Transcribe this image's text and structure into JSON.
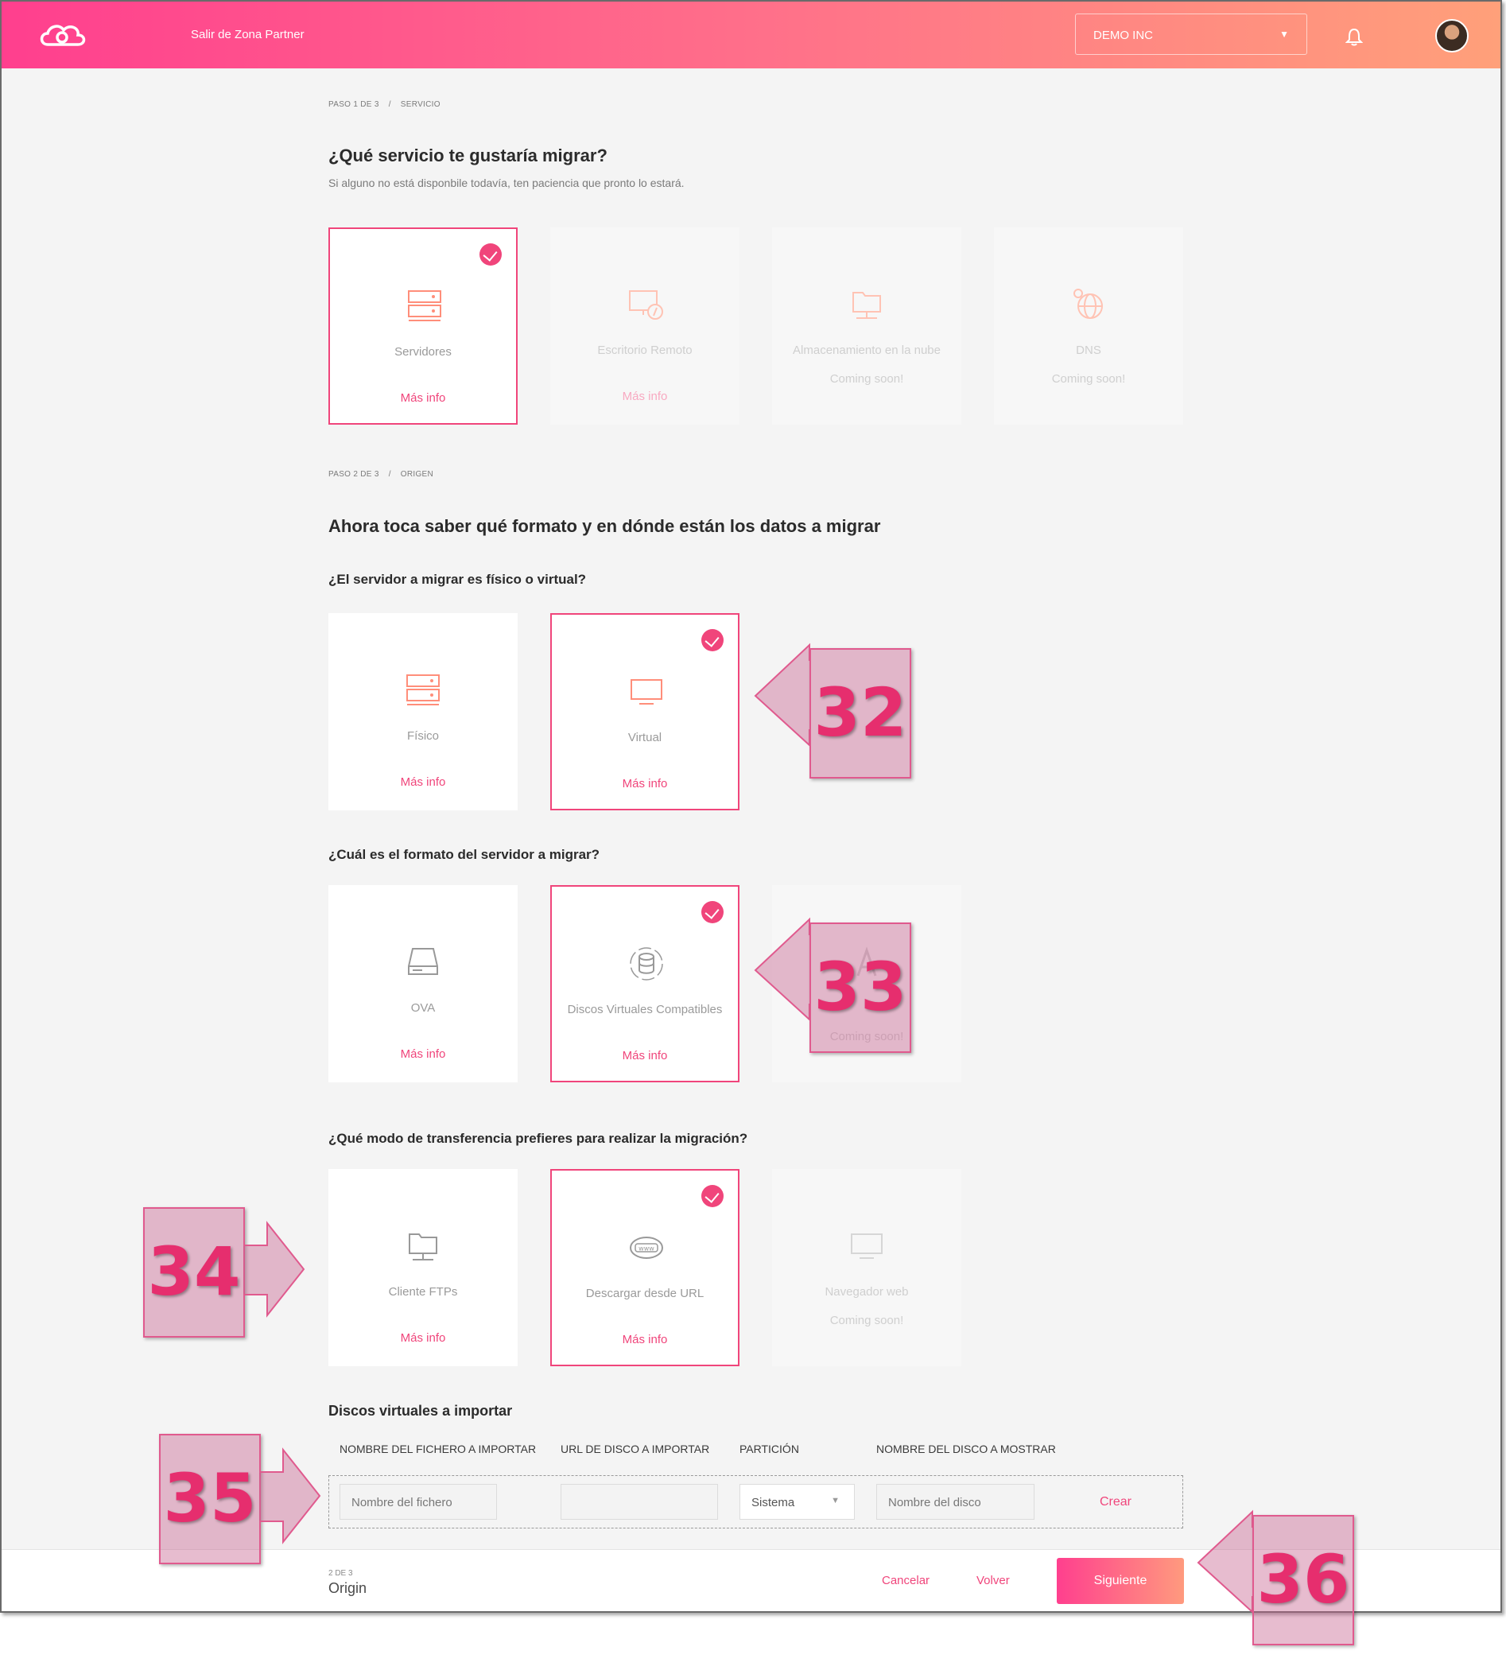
{
  "topbar": {
    "exit_label": "Salir de Zona Partner",
    "company": "DEMO INC",
    "caret": "▼"
  },
  "step1": {
    "crumb_step": "PASO 1 DE 3",
    "crumb_sep": "/",
    "crumb_name": "SERVICIO",
    "title": "¿Qué servicio te gustaría migrar?",
    "subtitle": "Si alguno no está disponbile todavía, ten paciencia que pronto lo estará.",
    "cards": [
      {
        "label": "Servidores",
        "more": "Más info",
        "icon": "server-icon",
        "selected": true
      },
      {
        "label": "Escritorio Remoto",
        "more": "Más info",
        "icon": "remote-desktop-icon",
        "disabled": true
      },
      {
        "label": "Almacenamiento en la nube",
        "soon": "Coming soon!",
        "icon": "cloud-storage-folder-icon",
        "disabled": true
      },
      {
        "label": "DNS",
        "soon": "Coming soon!",
        "icon": "globe-icon",
        "disabled": true
      }
    ]
  },
  "step2": {
    "crumb_step": "PASO 2 DE 3",
    "crumb_sep": "/",
    "crumb_name": "ORIGEN",
    "title": "Ahora toca saber qué formato y en dónde están los datos a migrar",
    "q1": "¿El servidor a migrar es físico o virtual?",
    "q1_cards": [
      {
        "label": "Físico",
        "more": "Más info",
        "icon": "server-icon"
      },
      {
        "label": "Virtual",
        "more": "Más info",
        "icon": "monitor-icon",
        "selected": true
      }
    ],
    "q2": "¿Cuál es el formato del servidor a migrar?",
    "q2_cards": [
      {
        "label": "OVA",
        "more": "Más info",
        "icon": "hard-drive-icon"
      },
      {
        "label": "Discos Virtuales Compatibles",
        "more": "Más info",
        "icon": "database-icon",
        "selected": true
      },
      {
        "soon": "Coming soon!",
        "icon": "letter-a-icon",
        "disabled": true
      }
    ],
    "q3": "¿Qué modo de transferencia prefieres para realizar la migración?",
    "q3_cards": [
      {
        "label": "Cliente FTPs",
        "more": "Más info",
        "icon": "ftp-folder-icon"
      },
      {
        "label": "Descargar desde URL",
        "more": "Más info",
        "icon": "www-icon",
        "selected": true
      },
      {
        "label": "Navegador web",
        "soon": "Coming soon!",
        "icon": "browser-monitor-icon",
        "disabled": true
      }
    ]
  },
  "disks": {
    "title": "Discos virtuales a importar",
    "columns": [
      "NOMBRE DEL FICHERO A IMPORTAR",
      "URL DE DISCO A IMPORTAR",
      "PARTICIÓN",
      "NOMBRE DEL DISCO A MOSTRAR"
    ],
    "file_placeholder": "Nombre del fichero",
    "url_value": "",
    "partition_value": "Sistema",
    "partition_caret": "▼",
    "disk_placeholder": "Nombre del disco",
    "create_label": "Crear"
  },
  "footer": {
    "step_count": "2 DE 3",
    "step_name": "Origin",
    "cancel_label": "Cancelar",
    "back_label": "Volver",
    "next_label": "Siguiente"
  },
  "callouts": [
    "32",
    "33",
    "34",
    "35",
    "36"
  ],
  "colors": {
    "accent": "#f0457b",
    "gradient_start": "#ff3f8e",
    "gradient_end": "#ffa07a",
    "callout_fill": "#c65f8c"
  }
}
